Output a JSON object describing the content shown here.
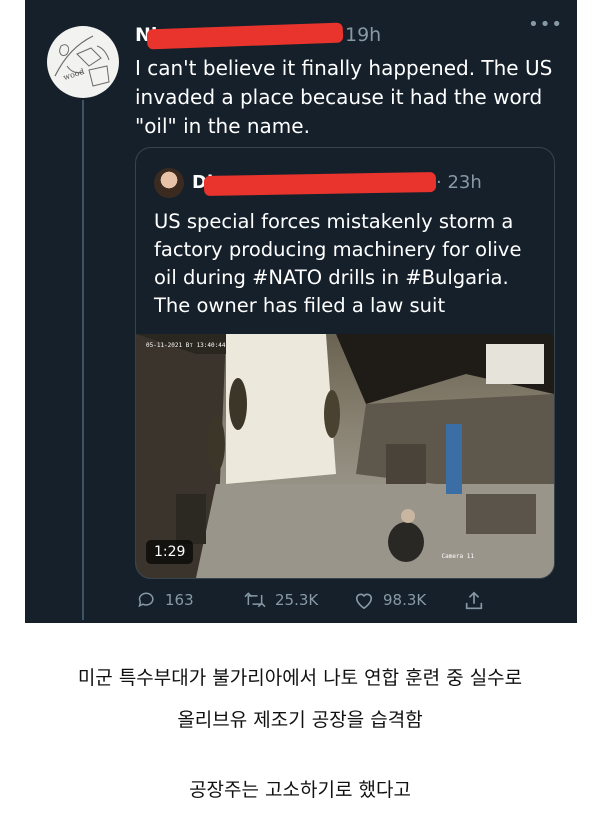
{
  "tweet": {
    "author_fragment": "Ni",
    "time": "19h",
    "more": "•••",
    "avatar_text": "wood",
    "text": "I can't believe it finally happened. The US invaded a place because it had the word \"oil\" in the name."
  },
  "quoted_tweet": {
    "author_fragment": "Di",
    "time": "· 23h",
    "text": "US special forces mistakenly storm a factory producing machinery for olive oil during #NATO drills in #Bulgaria. The owner has filed a law suit"
  },
  "video": {
    "timestamp": "05-11-2021 Вт 13:40:44",
    "camera_label": "Camera 11",
    "duration": "1:29"
  },
  "actions": {
    "replies": "163",
    "retweets": "25.3K",
    "likes": "98.3K"
  },
  "icons": [
    "reply-icon",
    "retweet-icon",
    "like-icon",
    "share-icon"
  ],
  "colors": {
    "background": "#15202b",
    "text": "#ffffff",
    "muted": "#8899a6",
    "border": "#38444d",
    "redaction": "#e8342c"
  },
  "caption": {
    "line1": "미군 특수부대가 불가리아에서 나토 연합 훈련 중 실수로",
    "line2": "올리브유 제조기 공장을 습격함",
    "line3": "공장주는 고소하기로 했다고"
  }
}
